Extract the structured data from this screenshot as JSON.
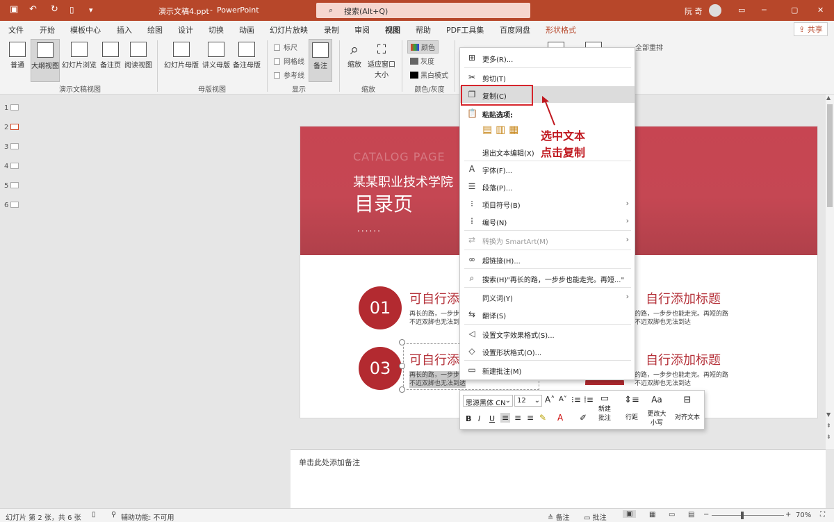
{
  "titlebar": {
    "filename": "演示文稿4.ppt",
    "app": "PowerPoint",
    "search": "搜索(Alt+Q)",
    "user": "阮 奇"
  },
  "menu": [
    "文件",
    "开始",
    "模板中心",
    "插入",
    "绘图",
    "设计",
    "切换",
    "动画",
    "幻灯片放映",
    "录制",
    "审阅",
    "视图",
    "帮助",
    "PDF工具集",
    "百度网盘",
    "形状格式"
  ],
  "share": "共享",
  "ribbon": {
    "views": [
      "普通",
      "大纲视图",
      "幻灯片浏览",
      "备注页",
      "阅读视图"
    ],
    "group_views": "演示文稿视图",
    "masters": [
      "幻灯片母版",
      "讲义母版",
      "备注母版"
    ],
    "group_masters": "母版视图",
    "show": [
      "标尺",
      "网格线",
      "参考线"
    ],
    "notes": "备注",
    "group_show": "显示",
    "zoom": "缩放",
    "fit": "适应窗口大小",
    "group_zoom": "缩放",
    "color": "颜色",
    "gray": "灰度",
    "bw": "黑白模式",
    "group_color": "颜色/灰度",
    "arrange_all": "全部重排"
  },
  "thumbs": [
    "1",
    "2",
    "3",
    "4",
    "5",
    "6"
  ],
  "slide": {
    "watermark": "CATALOG PAGE",
    "school": "某某职业技术学院",
    "title": "目录页",
    "dots": "......",
    "items": [
      {
        "num": "01",
        "title": "可自行添",
        "desc1": "再长的路，一步步",
        "desc2": "不迈双脚也无法到"
      },
      {
        "num": "03",
        "title": "可自行添",
        "desc1": "再长的路，一步步",
        "desc2": "不迈双脚也无法到达"
      }
    ],
    "right_items": [
      {
        "title": "自行添加标题",
        "desc1": "的路，一步步也能走完。再短的路",
        "desc2": "不迈双脚也无法到达"
      },
      {
        "title": "自行添加标题",
        "desc1": "的路，一步步也能走完。再短的路",
        "desc2": "不迈双脚也无法到达"
      }
    ]
  },
  "context": {
    "more": "更多(R)...",
    "cut": "剪切(T)",
    "copy": "复制(C)",
    "paste_opts": "粘贴选项:",
    "exit_edit": "退出文本编辑(X)",
    "font": "字体(F)...",
    "para": "段落(P)...",
    "bullets": "项目符号(B)",
    "numbering": "编号(N)",
    "smartart": "转换为 SmartArt(M)",
    "hyperlink": "超链接(H)...",
    "search": "搜索(H)\"再长的路，一步步也能走完。再短...\"",
    "synonyms": "同义词(Y)",
    "translate": "翻译(S)",
    "text_effects": "设置文字效果格式(S)...",
    "shape_format": "设置形状格式(O)...",
    "new_comment": "新建批注(M)"
  },
  "annotation": {
    "line1": "选中文本",
    "line2": "点击复制"
  },
  "mini": {
    "font": "思源黑体 CN",
    "size": "12",
    "new_comment_1": "新建",
    "new_comment_2": "批注",
    "line_spacing": "行距",
    "change_case_1": "更改大",
    "change_case_2": "小写",
    "align_text": "对齐文本"
  },
  "notes_placeholder": "单击此处添加备注",
  "status": {
    "slide": "幻灯片 第 2 张，共 6 张",
    "access": "辅助功能: 不可用",
    "notes": "备注",
    "comments": "批注",
    "zoom": "70%"
  },
  "colors": {
    "title": "#b7472a",
    "accent": "#b32a30",
    "highlight": "#c0181f"
  }
}
